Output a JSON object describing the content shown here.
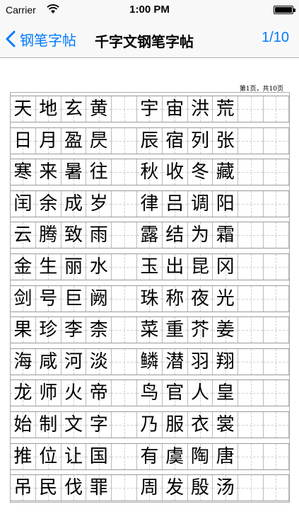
{
  "status": {
    "carrier": "Carrier",
    "time": "1:00 PM"
  },
  "nav": {
    "back_label": "钢笔字帖",
    "title": "千字文钢笔字帖",
    "pager": "1/10"
  },
  "page_info": "第1页，共10页",
  "rows": [
    [
      "天",
      "地",
      "玄",
      "黄",
      "",
      "宇",
      "宙",
      "洪",
      "荒",
      "",
      ""
    ],
    [
      "日",
      "月",
      "盈",
      "昃",
      "",
      "辰",
      "宿",
      "列",
      "张",
      "",
      ""
    ],
    [
      "寒",
      "来",
      "暑",
      "往",
      "",
      "秋",
      "收",
      "冬",
      "藏",
      "",
      ""
    ],
    [
      "闰",
      "余",
      "成",
      "岁",
      "",
      "律",
      "吕",
      "调",
      "阳",
      "",
      ""
    ],
    [
      "云",
      "腾",
      "致",
      "雨",
      "",
      "露",
      "结",
      "为",
      "霜",
      "",
      ""
    ],
    [
      "金",
      "生",
      "丽",
      "水",
      "",
      "玉",
      "出",
      "昆",
      "冈",
      "",
      ""
    ],
    [
      "剑",
      "号",
      "巨",
      "阙",
      "",
      "珠",
      "称",
      "夜",
      "光",
      "",
      ""
    ],
    [
      "果",
      "珍",
      "李",
      "柰",
      "",
      "菜",
      "重",
      "芥",
      "姜",
      "",
      ""
    ],
    [
      "海",
      "咸",
      "河",
      "淡",
      "",
      "鳞",
      "潜",
      "羽",
      "翔",
      "",
      ""
    ],
    [
      "龙",
      "师",
      "火",
      "帝",
      "",
      "鸟",
      "官",
      "人",
      "皇",
      "",
      ""
    ],
    [
      "始",
      "制",
      "文",
      "字",
      "",
      "乃",
      "服",
      "衣",
      "裳",
      "",
      ""
    ],
    [
      "推",
      "位",
      "让",
      "国",
      "",
      "有",
      "虞",
      "陶",
      "唐",
      "",
      ""
    ],
    [
      "吊",
      "民",
      "伐",
      "罪",
      "",
      "周",
      "发",
      "殷",
      "汤",
      "",
      ""
    ]
  ]
}
